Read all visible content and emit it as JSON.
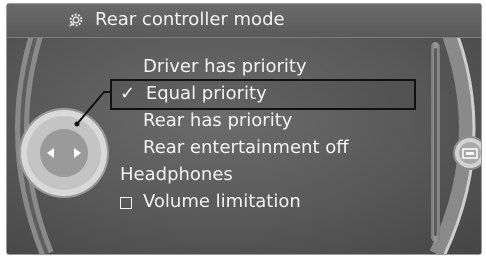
{
  "header": {
    "title": "Rear controller mode",
    "icon": "gear-icon"
  },
  "menu": {
    "items": [
      {
        "label": "Driver has priority",
        "selected": false
      },
      {
        "label": "Equal priority",
        "selected": true,
        "check_glyph": "✓"
      },
      {
        "label": "Rear has priority",
        "selected": false
      },
      {
        "label": "Rear entertainment off",
        "selected": false
      }
    ],
    "section_label": "Headphones",
    "option": {
      "label": "Volume limitation",
      "checked": false
    }
  },
  "controller": {
    "icons": [
      "arrow-left-icon",
      "arrow-right-icon"
    ],
    "right_button_icon": "screen-icon"
  }
}
